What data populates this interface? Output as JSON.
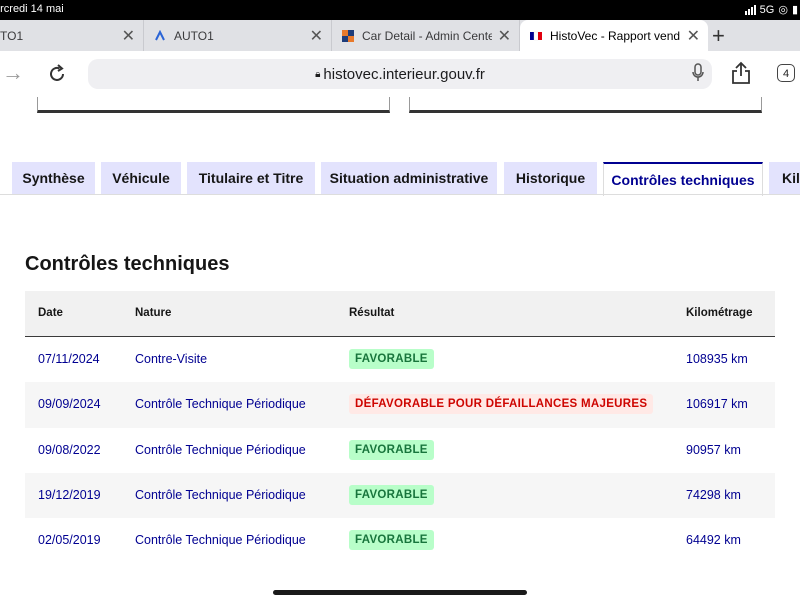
{
  "status": {
    "time": "ercredi 14 mai",
    "network": "5G"
  },
  "browser": {
    "tabs": [
      {
        "title": "TO1"
      },
      {
        "title": "AUTO1"
      },
      {
        "title": "Car Detail - Admin Cente"
      },
      {
        "title": "HistoVec - Rapport vend"
      }
    ],
    "url": "histovec.interieur.gouv.fr",
    "tab_count": "4",
    "new_tab": "+"
  },
  "page_tabs": [
    "Synthèse",
    "Véhicule",
    "Titulaire et Titre",
    "Situation administrative",
    "Historique",
    "Contrôles techniques",
    "Kilo"
  ],
  "section": {
    "title": "Contrôles techniques"
  },
  "table": {
    "headers": [
      "Date",
      "Nature",
      "Résultat",
      "Kilométrage"
    ],
    "rows": [
      [
        "07/11/2024",
        "Contre-Visite",
        "FAVORABLE",
        "108935 km"
      ],
      [
        "09/09/2024",
        "Contrôle Technique Périodique",
        "DÉFAVORABLE POUR DÉFAILLANCES MAJEURES",
        "106917 km"
      ],
      [
        "09/08/2022",
        "Contrôle Technique Périodique",
        "FAVORABLE",
        "90957 km"
      ],
      [
        "19/12/2019",
        "Contrôle Technique Périodique",
        "FAVORABLE",
        "74298 km"
      ],
      [
        "02/05/2019",
        "Contrôle Technique Périodique",
        "FAVORABLE",
        "64492 km"
      ]
    ]
  },
  "colors": {
    "accent": "#000091",
    "favorable": "#18753c",
    "defavorable": "#ce0500"
  }
}
